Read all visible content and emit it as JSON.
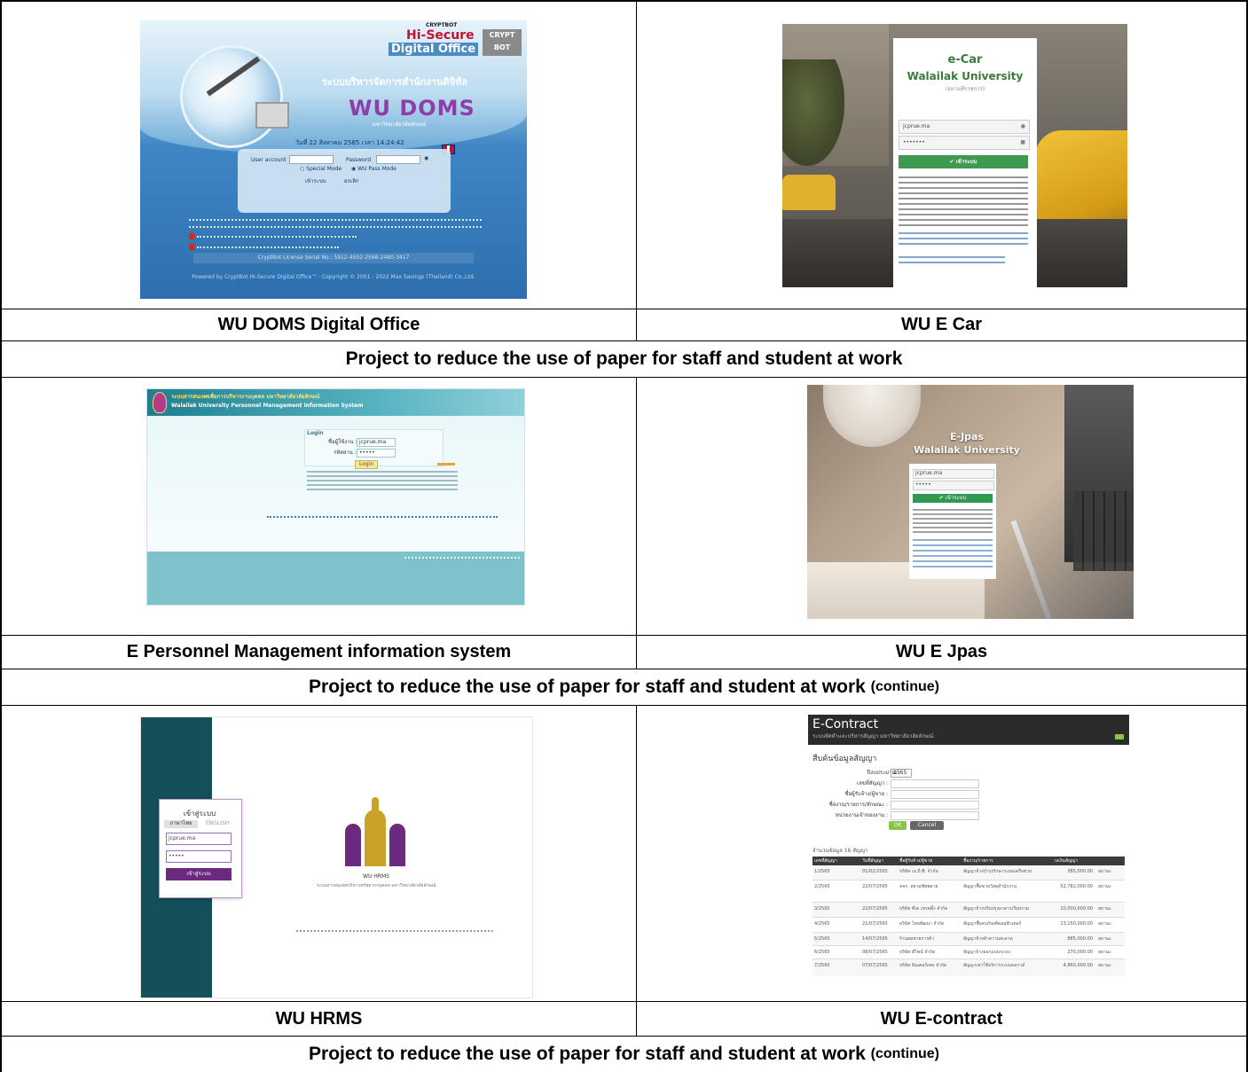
{
  "captions": {
    "row1_left": "WU DOMS Digital Office",
    "row1_right": "WU E Car",
    "banner1": "Project to reduce the use of paper for staff and student at work",
    "row2_left": "E Personnel Management information system",
    "row2_right": "WU E Jpas",
    "banner2": "Project to reduce the use of paper for staff and student at work",
    "banner2_suffix": "(continue)",
    "row3_left": "WU HRMS",
    "row3_right": "WU E-contract",
    "banner3": "Project to reduce the use of paper for staff and student at work",
    "banner3_suffix": "(continue)"
  },
  "doms": {
    "brand_top": "CRYPTBOT",
    "brand_mid": "Hi-Secure",
    "brand_bottom": "Digital Office",
    "brand_badge": "CRYPT BOT",
    "thai_title": "ระบบบริหารจัดการสำนักงานดิจิทัล",
    "logo": "WU DOMS",
    "university": "มหาวิทยาลัยวลัยลักษณ์",
    "datetime": "วันที่ 22 สิงหาคม 2565 เวลา 14:24:42",
    "user_label": "User account",
    "pass_label": "Password",
    "mode_special": "Special Mode",
    "mode_wu": "WU Pass Mode",
    "login_btn": "เข้าระบบ",
    "cancel_btn": "ยกเลิก",
    "license": "CryptBot License Serial No.: 5912-4502-2568-2480-3417",
    "footer": "Powered by CryptBot Hi-Secure Digital Office™ · Copyright © 2001 - 2022 Max Savings (Thailand) Co.,Ltd."
  },
  "ecar": {
    "title": "e-Car",
    "org": "Walailak University",
    "sub": "(สถานที่ราชการ)",
    "user_value": "jcprue.ma",
    "pass_value": "•••••••",
    "login_btn": "✔ เข้าระบบ"
  },
  "pmis": {
    "thai_title": "ระบบสารสนเทศเพื่อการบริหารงานบุคคล มหาวิทยาลัยวลัยลักษณ์",
    "en_title": "Walailak University Personnel Management Information System",
    "box_title": "Login",
    "user_label": "ชื่อผู้ใช้งาน :",
    "user_value": "jcprue.ma",
    "pass_label": "รหัสผ่าน :",
    "pass_value": "•••••",
    "login_btn": "Login"
  },
  "ejpas": {
    "title": "E-Jpas",
    "org": "Walailak University",
    "user_value": "jcprue.ma",
    "pass_value": "•••••",
    "login_btn": "✔ เข้าระบบ"
  },
  "hrms": {
    "login_title": "เข้าสู่ระบบ",
    "tab_thai": "ภาษาไทย",
    "tab_en": "ENGLISH",
    "user_value": "jcprue.ma",
    "pass_value": "•••••",
    "submit": "เข้าสู่ระบบ",
    "logo_text": "WU HRMS",
    "logo_sub": "ระบบสารสนเทศบริหารทรัพยากรบุคคล มหาวิทยาลัยวลัยลักษณ์"
  },
  "econtract": {
    "app_title": "E-Contract",
    "app_sub": "ระบบจัดทำและบริหารสัญญา มหาวิทยาลัยวลัยลักษณ์",
    "section": "สืบค้นข้อมูลสัญญา",
    "year_label": "ปีงบประมาณ :",
    "year_value": "2565",
    "f1": "เลขที่สัญญา :",
    "f2": "ชื่อผู้รับจ้าง/ผู้ขาย :",
    "f3": "ชื่องาน/รายการ/ลักษณะ :",
    "f4": "หน่วยงานเจ้าของงาน :",
    "ok_btn": "OK",
    "cancel_btn": "Cancel",
    "count": "จำนวนข้อมูล 16 สัญญา",
    "headers": [
      "เลขที่สัญญา",
      "วันที่สัญญา",
      "ชื่อผู้รับจ้าง/ผู้ขาย",
      "ชื่องาน/รายการ",
      "วงเงินสัญญา",
      ""
    ],
    "rows": [
      [
        "1/2565",
        "01/02/2565",
        "บริษัท เอ.บี.ซี. จำกัด",
        "สัญญาจ้างบำรุงรักษาระบบเครือข่าย",
        "385,000.00",
        "สถานะ"
      ],
      [
        "2/2565",
        "22/07/2565",
        "หจก. สยามซัพพลาย",
        "สัญญาซื้อขายวัสดุสำนักงาน",
        "52,782,000.00",
        "สถานะ"
      ],
      [
        "3/2565",
        "22/07/2565",
        "บริษัท ทีเค เทรดดิ้ง จำกัด",
        "สัญญาจ้างปรับปรุงอาคารเรียนรวม",
        "10,000,000.00",
        "สถานะ"
      ],
      [
        "4/2565",
        "21/07/2565",
        "บริษัท ไทยพัฒนา จำกัด",
        "สัญญาซื้อครุภัณฑ์คอมพิวเตอร์",
        "13,150,000.00",
        "สถานะ"
      ],
      [
        "5/2565",
        "14/07/2565",
        "ร้านสมชายการค้า",
        "สัญญาจ้างทำความสะอาด",
        "885,000.00",
        "สถานะ"
      ],
      [
        "6/2565",
        "08/07/2565",
        "บริษัท ดีไซน์ จำกัด",
        "สัญญาจ้างออกแบบระบบ",
        "270,000.00",
        "สถานะ"
      ],
      [
        "7/2565",
        "07/07/2565",
        "บริษัท อินเตอร์เทค จำกัด",
        "สัญญาเช่าใช้บริการระบบคลาวด์",
        "4,860,000.00",
        "สถานะ"
      ]
    ]
  }
}
